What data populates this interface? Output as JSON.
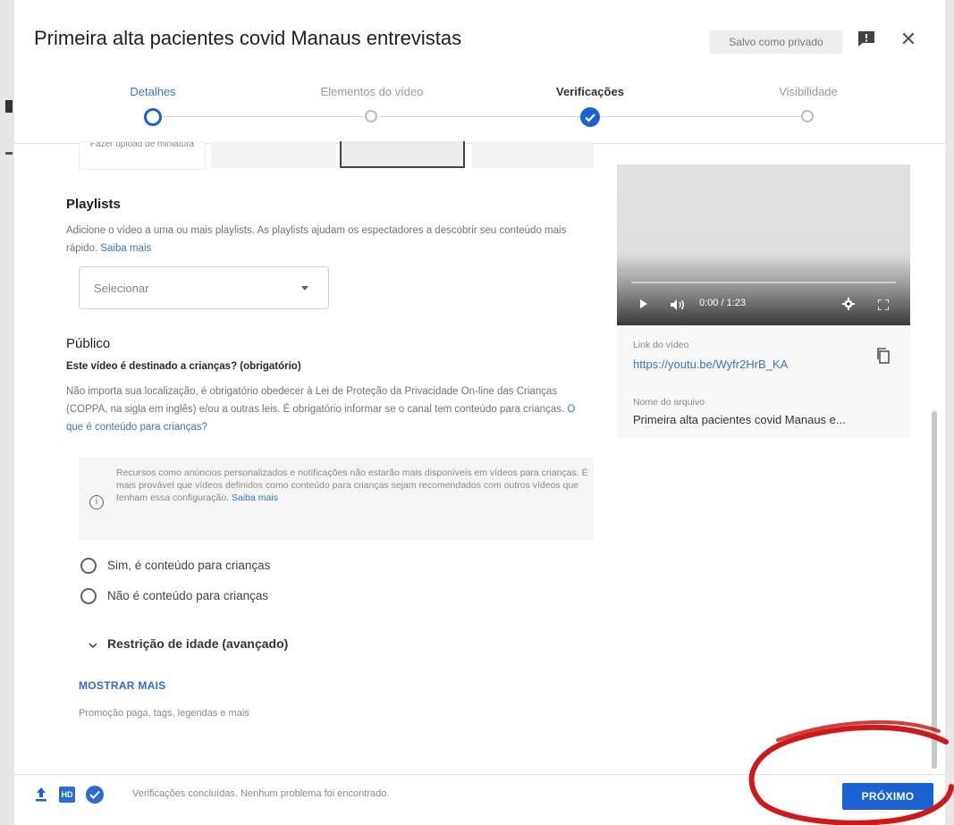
{
  "dialog": {
    "title": "Primeira alta pacientes covid Manaus entrevistas",
    "saved_badge": "Salvo como privado"
  },
  "stepper": {
    "steps": [
      {
        "label": "Detalhes",
        "state": "current"
      },
      {
        "label": "Elementos do vídeo",
        "state": "pending"
      },
      {
        "label": "Verificações",
        "state": "done"
      },
      {
        "label": "Visibilidade",
        "state": "pending"
      }
    ]
  },
  "thumbnail": {
    "upload_label": "Fazer upload de miniatura"
  },
  "playlists": {
    "heading": "Playlists",
    "description": "Adicione o vídeo a uma ou mais playlists. As playlists ajudam os espectadores a descobrir seu conteúdo mais rápido.",
    "learn_more": "Saiba mais",
    "select_value": "Selecionar"
  },
  "audience": {
    "heading": "Público",
    "question": "Este vídeo é destinado a crianças? (obrigatório)",
    "description": "Não importa sua localização, é obrigatório obedecer à Lei de Proteção da Privacidade On-line das Crianças (COPPA, na sigla em inglês) e/ou a outras leis. É obrigatório informar se o canal tem conteúdo para crianças.",
    "what_is_link": "O que é conteúdo para crianças?",
    "info_text": "Recursos como anúncios personalizados e notificações não estarão mais disponíveis em vídeos para crianças. É mais provável que vídeos definidos como conteúdo para crianças sejam recomendados com outros vídeos que tenham essa configuração.",
    "info_link": "Saiba mais",
    "option_yes": "Sim, é conteúdo para crianças",
    "option_no": "Não é conteúdo para crianças",
    "age_restriction": "Restrição de idade (avançado)"
  },
  "show_more": {
    "label": "MOSTRAR MAIS",
    "sub": "Promoção paga, tags, legendas e mais"
  },
  "player": {
    "time": "0:00 / 1:23"
  },
  "video_info": {
    "link_label": "Link do vídeo",
    "link": "https://youtu.be/Wyfr2HrB_KA",
    "filename_label": "Nome do arquivo",
    "filename": "Primeira alta pacientes covid Manaus e..."
  },
  "footer": {
    "status": "Verificações concluídas. Nenhum problema foi encontrado.",
    "next_button": "PRÓXIMO",
    "hd_badge": "HD"
  },
  "colors": {
    "accent": "#1a62d4",
    "link": "#3a73c8",
    "annotation": "#d01818"
  }
}
